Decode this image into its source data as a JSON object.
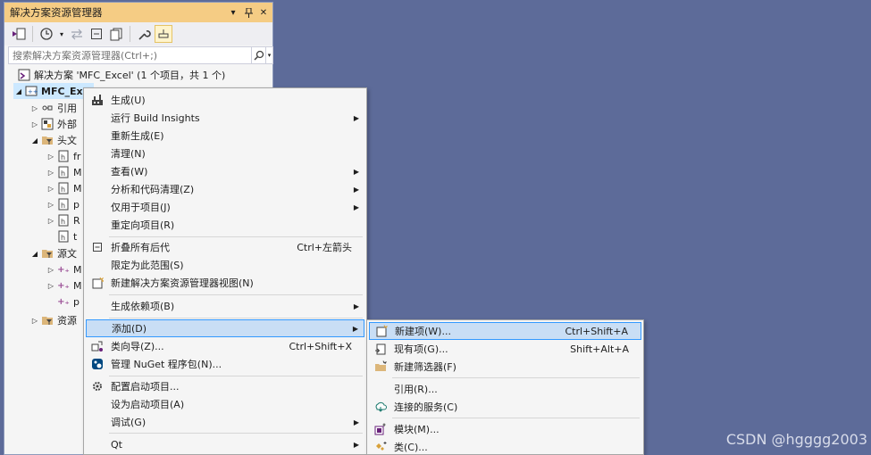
{
  "panel": {
    "title": "解决方案资源管理器",
    "title_buttons": [
      "▾",
      "ᵖ",
      "✕"
    ],
    "search_placeholder": "搜索解决方案资源管理器(Ctrl+;)"
  },
  "tree": {
    "solution_label": "解决方案 'MFC_Excel' (1 个项目，共 1 个)",
    "project_label": "MFC_Ex",
    "items": [
      {
        "label": "引用"
      },
      {
        "label": "外部"
      },
      {
        "label": "头文"
      },
      {
        "label": "fr"
      },
      {
        "label": "M"
      },
      {
        "label": "M"
      },
      {
        "label": "p"
      },
      {
        "label": "R"
      },
      {
        "label": "t"
      },
      {
        "label": "源文"
      },
      {
        "label": "M"
      },
      {
        "label": "M"
      },
      {
        "label": "p"
      },
      {
        "label": "资源"
      }
    ]
  },
  "context_menu": {
    "items": [
      {
        "label": "生成(U)",
        "icon": "build-icon"
      },
      {
        "label": "运行 Build Insights",
        "submenu": true
      },
      {
        "label": "重新生成(E)"
      },
      {
        "label": "清理(N)"
      },
      {
        "label": "查看(W)",
        "submenu": true
      },
      {
        "label": "分析和代码清理(Z)",
        "submenu": true
      },
      {
        "label": "仅用于项目(J)",
        "submenu": true
      },
      {
        "label": "重定向项目(R)"
      },
      {
        "label": "折叠所有后代",
        "shortcut": "Ctrl+左箭头",
        "icon": "collapse-icon"
      },
      {
        "label": "限定为此范围(S)"
      },
      {
        "label": "新建解决方案资源管理器视图(N)",
        "icon": "new-view-icon"
      },
      {
        "label": "生成依赖项(B)",
        "submenu": true
      },
      {
        "label": "添加(D)",
        "submenu": true
      },
      {
        "label": "类向导(Z)...",
        "shortcut": "Ctrl+Shift+X",
        "icon": "class-wizard-icon"
      },
      {
        "label": "管理 NuGet 程序包(N)...",
        "icon": "nuget-icon"
      },
      {
        "label": "配置启动项目...",
        "icon": "gear-icon"
      },
      {
        "label": "设为启动项目(A)"
      },
      {
        "label": "调试(G)",
        "submenu": true
      },
      {
        "label": "Qt",
        "submenu": true
      }
    ]
  },
  "add_submenu": {
    "items": [
      {
        "label": "新建项(W)...",
        "shortcut": "Ctrl+Shift+A",
        "icon": "new-item-icon"
      },
      {
        "label": "现有项(G)...",
        "shortcut": "Shift+Alt+A",
        "icon": "existing-item-icon"
      },
      {
        "label": "新建筛选器(F)",
        "icon": "new-filter-icon"
      },
      {
        "label": "引用(R)..."
      },
      {
        "label": "连接的服务(C)",
        "icon": "connected-service-icon"
      },
      {
        "label": "模块(M)...",
        "icon": "module-icon"
      },
      {
        "label": "类(C)...",
        "icon": "class-icon"
      }
    ]
  },
  "watermark": "CSDN @hgggg2003"
}
